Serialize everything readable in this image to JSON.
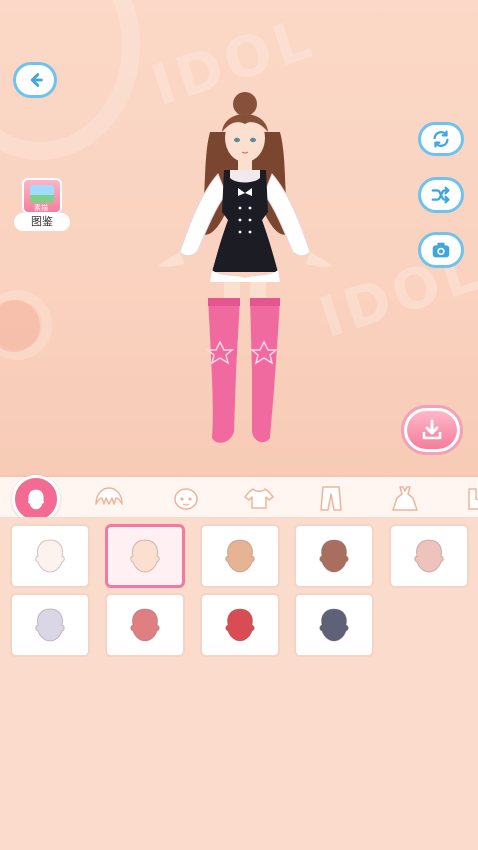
{
  "stage": {
    "watermark": "IDOL",
    "back_icon": "back-arrow-icon",
    "right_buttons": [
      {
        "name": "reset-button",
        "icon": "refresh-icon"
      },
      {
        "name": "random-button",
        "icon": "shuffle-icon"
      },
      {
        "name": "camera-button",
        "icon": "camera-icon"
      }
    ],
    "gallery": {
      "badge": "素描",
      "label": "图鉴"
    },
    "save_icon": "download-tray-icon"
  },
  "tabs": [
    {
      "name": "tab-skin",
      "icon": "head-icon",
      "active": true
    },
    {
      "name": "tab-hair",
      "icon": "hair-icon",
      "active": false
    },
    {
      "name": "tab-face",
      "icon": "face-icon",
      "active": false
    },
    {
      "name": "tab-top",
      "icon": "shirt-icon",
      "active": false
    },
    {
      "name": "tab-pants",
      "icon": "pants-icon",
      "active": false
    },
    {
      "name": "tab-dress",
      "icon": "dress-icon",
      "active": false
    },
    {
      "name": "tab-shoes",
      "icon": "shoe-icon",
      "active": false
    }
  ],
  "skin_tones": [
    {
      "color": "#fdf3ee",
      "selected": false
    },
    {
      "color": "#fbe0cf",
      "selected": true
    },
    {
      "color": "#e6b494",
      "selected": false
    },
    {
      "color": "#a86f5f",
      "selected": false
    },
    {
      "color": "#edc3bb",
      "selected": false
    },
    {
      "color": "#d9d6e6",
      "selected": false
    },
    {
      "color": "#df7f82",
      "selected": false
    },
    {
      "color": "#d94c55",
      "selected": false
    },
    {
      "color": "#5e6178",
      "selected": false
    }
  ],
  "colors": {
    "accent_pink": "#f36a93",
    "accent_blue": "#6ec3ee",
    "background": "#f8d3c2"
  }
}
